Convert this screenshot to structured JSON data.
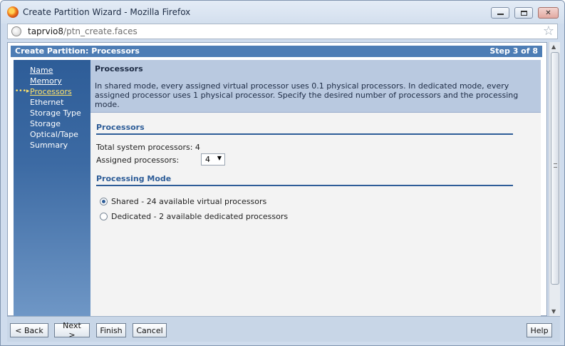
{
  "window": {
    "title": "Create Partition Wizard - Mozilla Firefox",
    "url_host": "taprvio8",
    "url_path": "/ptn_create.faces"
  },
  "wizard": {
    "header_title": "Create Partition: Processors",
    "step_text": "Step 3 of 8"
  },
  "sidebar": {
    "items": [
      {
        "label": "Name",
        "state": "visited"
      },
      {
        "label": "Memory",
        "state": "visited"
      },
      {
        "label": "Processors",
        "state": "current"
      },
      {
        "label": "Ethernet",
        "state": "pending"
      },
      {
        "label": "Storage Type",
        "state": "pending"
      },
      {
        "label": "Storage",
        "state": "pending"
      },
      {
        "label": "Optical/Tape",
        "state": "pending"
      },
      {
        "label": "Summary",
        "state": "pending"
      }
    ]
  },
  "info": {
    "title": "Processors",
    "text": "In shared mode, every assigned virtual processor uses 0.1 physical processors. In dedicated mode, every assigned processor uses 1 physical processor. Specify the desired number of processors and the processing mode."
  },
  "processors": {
    "section_title": "Processors",
    "total_label": "Total system processors: 4",
    "assigned_label": "Assigned processors:",
    "assigned_value": "4"
  },
  "processing_mode": {
    "section_title": "Processing Mode",
    "options": [
      {
        "label": "Shared - 24 available virtual processors",
        "selected": true
      },
      {
        "label": "Dedicated - 2 available dedicated processors",
        "selected": false
      }
    ]
  },
  "footer": {
    "back_label": "< Back",
    "next_label": "Next >",
    "finish_label": "Finish",
    "cancel_label": "Cancel",
    "help_label": "Help"
  },
  "colors": {
    "accent": "#2e5d98",
    "header_bar": "#4d7db5",
    "current_nav": "#ffe36b"
  }
}
